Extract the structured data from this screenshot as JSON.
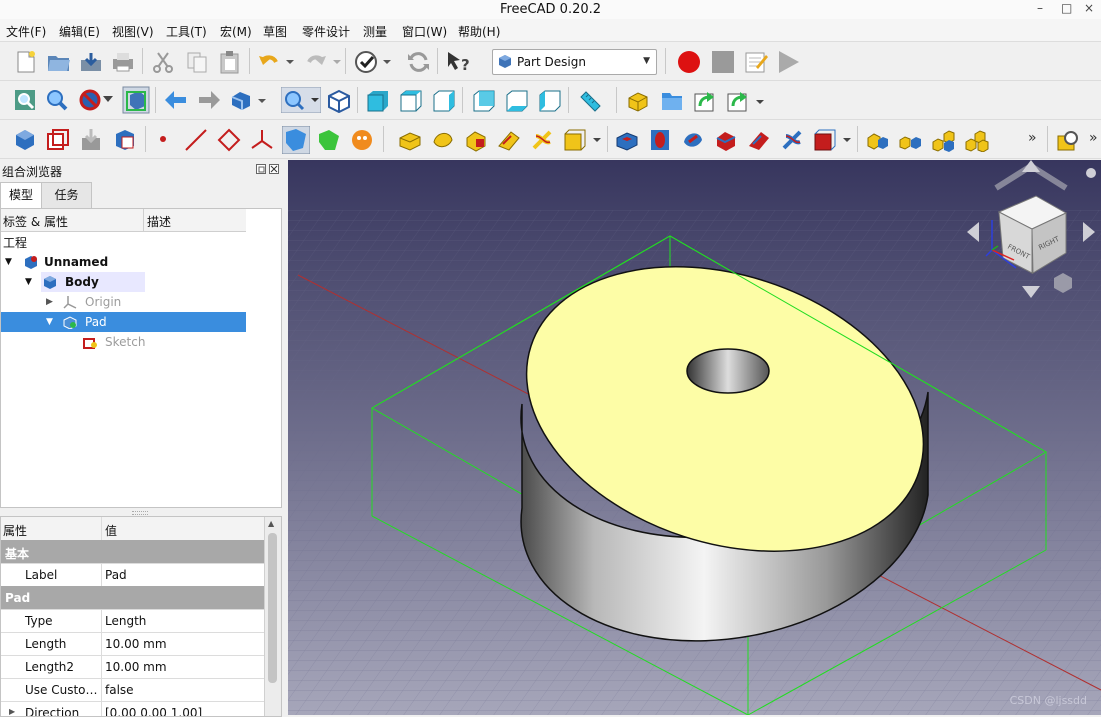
{
  "window": {
    "title": "FreeCAD 0.20.2",
    "minimize": "–",
    "maximize": "□",
    "close": "×"
  },
  "menu": {
    "file": "文件(F)",
    "edit": "编辑(E)",
    "view": "视图(V)",
    "tools": "工具(T)",
    "macro": "宏(M)",
    "sketch": "草图",
    "part_design": "零件设计",
    "measure": "测量",
    "window": "窗口(W)",
    "help": "帮助(H)"
  },
  "toolbar": {
    "workbench_selector": "Part Design",
    "overflow": "»"
  },
  "combo_view": {
    "title": "组合浏览器",
    "tabs": {
      "model": "模型",
      "tasks": "任务"
    },
    "tree_headers": {
      "label": "标签 & 属性",
      "description": "描述"
    },
    "section": "工程",
    "items": {
      "document": "Unnamed",
      "body": "Body",
      "origin": "Origin",
      "pad": "Pad",
      "sketch": "Sketch"
    }
  },
  "property_editor": {
    "headers": {
      "property": "属性",
      "value": "值"
    },
    "groups": {
      "base": "基本",
      "pad": "Pad"
    },
    "rows": {
      "label": {
        "name": "Label",
        "value": "Pad"
      },
      "type": {
        "name": "Type",
        "value": "Length"
      },
      "length": {
        "name": "Length",
        "value": "10.00 mm"
      },
      "length2": {
        "name": "Length2",
        "value": "10.00 mm"
      },
      "use_custom": {
        "name": "Use Custo…",
        "value": "false"
      },
      "direction": {
        "name": "Direction",
        "value": "[0.00 0.00 1.00]"
      }
    }
  },
  "navigation_cube": {
    "front": "FRONT",
    "right": "RIGHT"
  },
  "viewport": {
    "watermark": "CSDN @ljssdd"
  },
  "colors": {
    "viewport_top": "#37365e",
    "viewport_bottom": "#a6a6ba",
    "face_top": "#fdfda6",
    "selection_blue": "#3a8dde",
    "bounding_box": "#22dd22",
    "record_red": "#dd1111"
  }
}
